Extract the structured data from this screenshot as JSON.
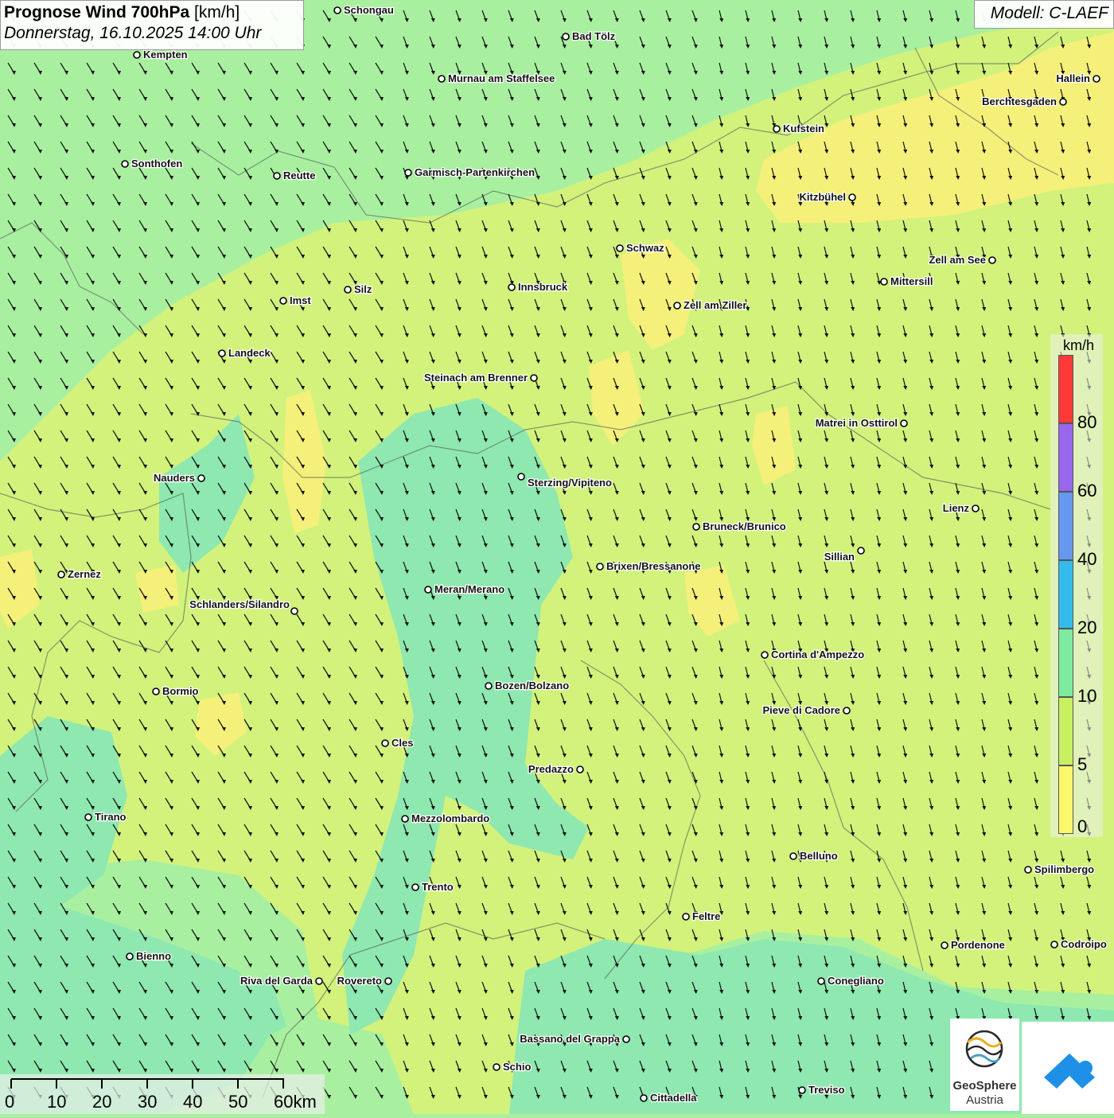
{
  "title": {
    "main": "Prognose Wind 700hPa",
    "unit": "[km/h]",
    "date": "Donnerstag, 16.10.2025 14:00 Uhr"
  },
  "model": "Modell: C-LAEF",
  "legend": {
    "unit": "km/h",
    "labels": [
      "80",
      "60",
      "40",
      "20",
      "10",
      "5",
      "0"
    ],
    "colors": [
      "#ff3838",
      "#9966ee",
      "#6699ee",
      "#33bbee",
      "#7eeaa0",
      "#c8f060",
      "#fcf86c"
    ]
  },
  "scale": {
    "labels": [
      "0",
      "10",
      "20",
      "30",
      "40",
      "50",
      "60km"
    ]
  },
  "logo": {
    "line1": "GeoSphere",
    "line2": "Austria"
  },
  "map_colors": {
    "green": "#a8f0a0",
    "yellowgreen": "#d2f27c",
    "yellow": "#f4f07a",
    "teal": "#8ee8b0"
  },
  "cities": [
    {
      "name": "Schongau"
    },
    {
      "name": "Bad Tölz"
    },
    {
      "name": "Kempten"
    },
    {
      "name": "Murnau am Staffelsee"
    },
    {
      "name": "Hallein"
    },
    {
      "name": "Berchtesgaden"
    },
    {
      "name": "Kufstein"
    },
    {
      "name": "Sonthofen"
    },
    {
      "name": "Reutte"
    },
    {
      "name": "Garmisch-Partenkirchen"
    },
    {
      "name": "Kitzbühel"
    },
    {
      "name": "Schwaz"
    },
    {
      "name": "Zell am See"
    },
    {
      "name": "Innsbruck"
    },
    {
      "name": "Mittersill"
    },
    {
      "name": "Silz"
    },
    {
      "name": "Imst"
    },
    {
      "name": "Zell am Ziller"
    },
    {
      "name": "Landeck"
    },
    {
      "name": "Steinach am Brenner"
    },
    {
      "name": "Matrei in Osttirol"
    },
    {
      "name": "Nauders"
    },
    {
      "name": "Sterzing/Vipiteno"
    },
    {
      "name": "Lienz"
    },
    {
      "name": "Bruneck/Brunico"
    },
    {
      "name": "Sillian"
    },
    {
      "name": "Zernez"
    },
    {
      "name": "Brixen/Bressanone"
    },
    {
      "name": "Meran/Merano"
    },
    {
      "name": "Schlanders/Silandro"
    },
    {
      "name": "Cortina d'Ampezzo"
    },
    {
      "name": "Bormio"
    },
    {
      "name": "Bozen/Bolzano"
    },
    {
      "name": "Pieve di Cadore"
    },
    {
      "name": "Cles"
    },
    {
      "name": "Predazzo"
    },
    {
      "name": "Tirano"
    },
    {
      "name": "Mezzolombardo"
    },
    {
      "name": "Belluno"
    },
    {
      "name": "Spilimbergo"
    },
    {
      "name": "Trento"
    },
    {
      "name": "Feltre"
    },
    {
      "name": "Pordenone"
    },
    {
      "name": "Codroipo"
    },
    {
      "name": "Bienno"
    },
    {
      "name": "Riva del Garda"
    },
    {
      "name": "Rovereto"
    },
    {
      "name": "Conegliano"
    },
    {
      "name": "Bassano del Grappa"
    },
    {
      "name": "Schio"
    },
    {
      "name": "Treviso"
    },
    {
      "name": "Cittadella"
    }
  ]
}
